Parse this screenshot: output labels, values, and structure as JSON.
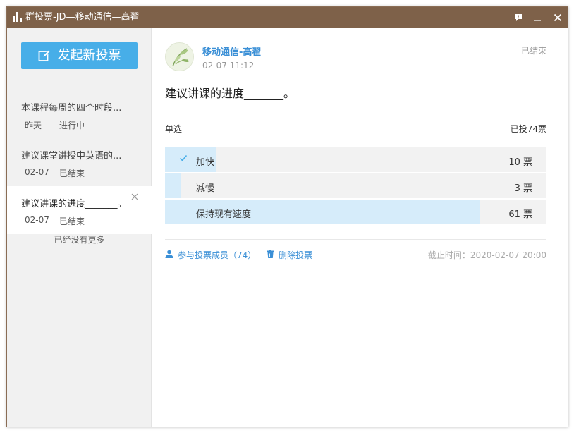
{
  "window": {
    "title": "群投票-JD—移动通信—高翟"
  },
  "sidebar": {
    "new_vote_label": "发起新投票",
    "items": [
      {
        "title": "本课程每周的四个时段...",
        "date": "昨天",
        "status": "进行中"
      },
      {
        "title": "建议课堂讲授中英语的...",
        "date": "02-07",
        "status": "已结束"
      },
      {
        "title": "建议讲课的进度_______。",
        "date": "02-07",
        "status": "已结束"
      }
    ],
    "no_more": "已经没有更多"
  },
  "detail": {
    "author": "移动通信-高翟",
    "time": "02-07 11:12",
    "status": "已结束",
    "question": "建议讲课的进度_______。",
    "vote_type": "单选",
    "total": "已投74票",
    "options": [
      {
        "label": "加快",
        "count": "10 票",
        "votes": 10,
        "selected": true
      },
      {
        "label": "减慢",
        "count": "3 票",
        "votes": 3,
        "selected": false
      },
      {
        "label": "保持现有速度",
        "count": "61 票",
        "votes": 61,
        "selected": false
      }
    ],
    "total_votes": 74,
    "members_link": "参与投票成员（74）",
    "delete_link": "删除投票",
    "deadline": "截止时间：2020-02-07 20:00"
  },
  "colors": {
    "titlebar": "#7e6149",
    "accent": "#47aee8",
    "link": "#3a8fd6",
    "option_fill": "#d6ecfa"
  },
  "icons": {
    "app": "bar-chart-icon",
    "feedback": "feedback-icon",
    "minimize": "minimize-icon",
    "close": "close-icon",
    "new_vote": "edit-icon",
    "members": "user-icon",
    "delete": "trash-icon",
    "check": "check-icon"
  }
}
